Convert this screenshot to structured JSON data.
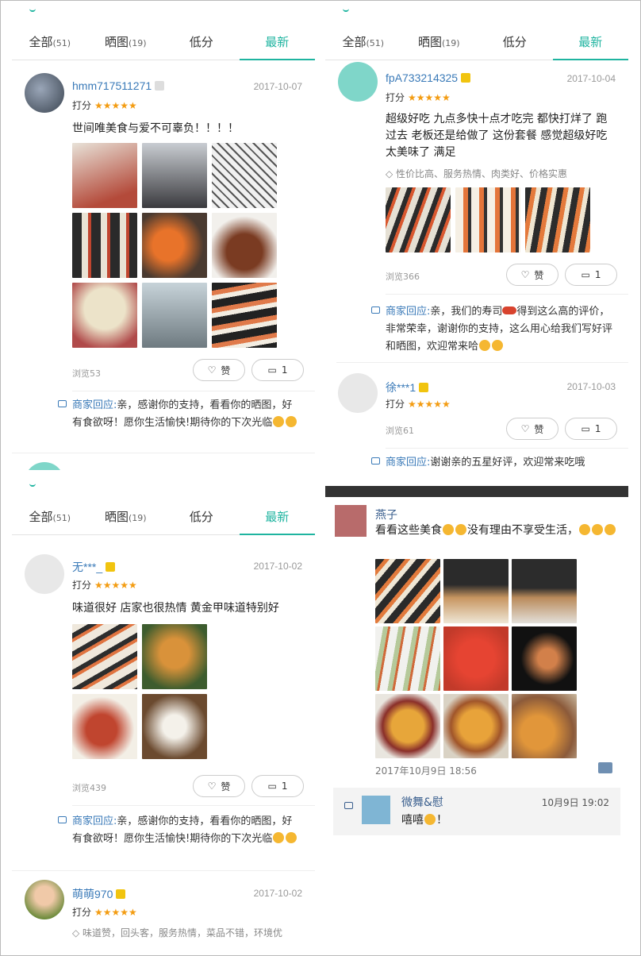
{
  "tabs": [
    {
      "label": "全部",
      "count": "(51)"
    },
    {
      "label": "晒图",
      "count": "(19)"
    },
    {
      "label": "低分",
      "count": ""
    },
    {
      "label": "最新",
      "count": ""
    }
  ],
  "ui": {
    "score_label": "打分",
    "stars": "★★★★★",
    "like_label": "赞",
    "reply_label": "商家回应:",
    "colors": {
      "accent": "#1fb4a0",
      "link": "#3a7ab8",
      "star": "#f39c12"
    }
  },
  "p1": {
    "r1": {
      "user": "hmm717511271",
      "date": "2017-10-07",
      "text": "世间唯美食与爱不可辜负！！！！",
      "views": "浏览53",
      "comments": "1",
      "reply": "亲，感谢你的支持，看看你的晒图，好有食欲呀！愿你生活愉快!期待你的下次光临"
    },
    "r2": {
      "user": "fpA733214325",
      "date": "2017-10-04"
    }
  },
  "p2": {
    "r1": {
      "user": "fpA733214325",
      "date": "2017-10-04",
      "text": "超级好吃 九点多快十点才吃完 都快打烊了 跑过去 老板还是给做了 这份套餐 感觉超级好吃 太美味了 满足",
      "tags": "性价比高、服务热情、肉类好、价格实惠",
      "views": "浏览366",
      "comments": "1",
      "reply_a": "亲，我们的寿司",
      "reply_b": "得到这么高的评价，非常荣幸，谢谢你的支持，这么用心给我们写好评和晒图，欢迎常来哈"
    },
    "r2": {
      "user": "徐***1",
      "date": "2017-10-03",
      "views": "浏览61",
      "comments": "1",
      "reply": "谢谢亲的五星好评，欢迎常来吃哦"
    }
  },
  "p3": {
    "r1": {
      "user": "无***_",
      "date": "2017-10-02",
      "text": "味道很好 店家也很热情 黄金甲味道特别好",
      "views": "浏览439",
      "comments": "1",
      "reply": "亲，感谢你的支持，看看你的晒图，好有食欲呀！愿你生活愉快!期待你的下次光临"
    },
    "r2": {
      "user": "萌萌970",
      "date": "2017-10-02",
      "tags": "味道赞，回头客，服务热情，菜品不错，环境优"
    }
  },
  "p4": {
    "name": "燕子",
    "text_a": "看看这些美食",
    "text_b": "没有理由不享受生活，",
    "time": "2017年10月9日 18:56",
    "comment": {
      "name": "微舞&慰",
      "time": "10月9日 19:02",
      "text": "嘻嘻",
      "text_end": "！"
    }
  }
}
